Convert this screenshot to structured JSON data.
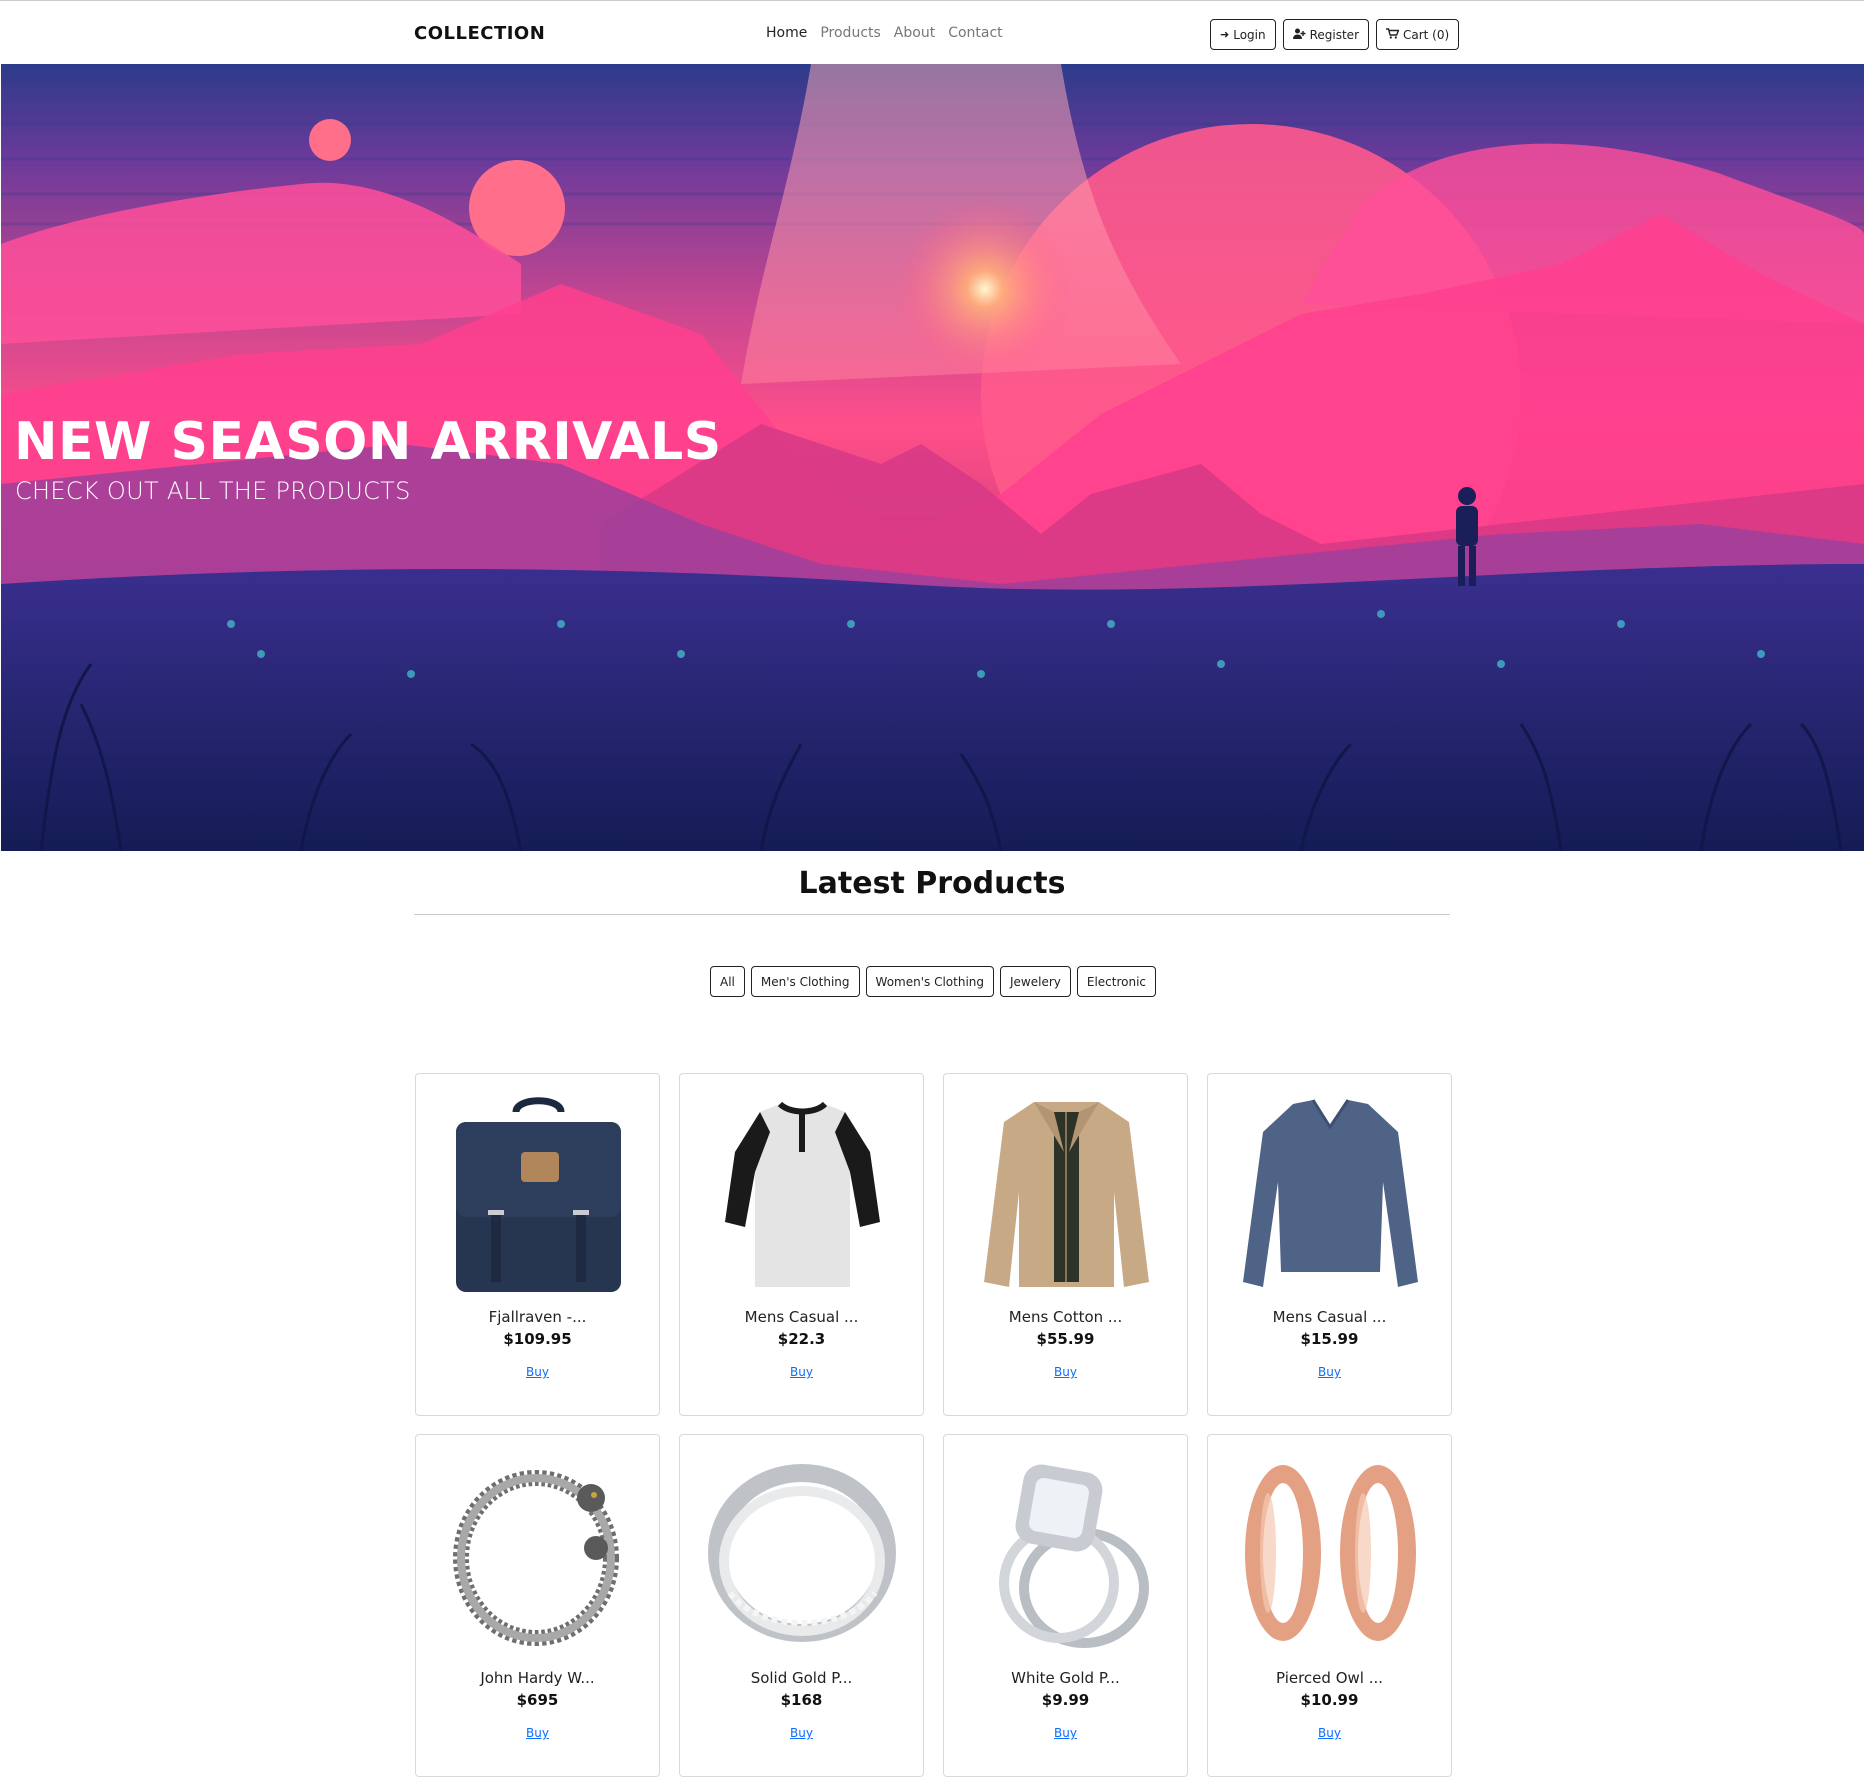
{
  "nav": {
    "brand": "COLLECTION",
    "links": [
      "Home",
      "Products",
      "About",
      "Contact"
    ],
    "login": "Login",
    "register": "Register",
    "cart": "Cart (0)"
  },
  "hero": {
    "title": "NEW SEASON ARRIVALS",
    "subtitle": "CHECK OUT ALL THE PRODUCTS"
  },
  "section": {
    "title": "Latest Products"
  },
  "filters": [
    "All",
    "Men's Clothing",
    "Women's Clothing",
    "Jewelery",
    "Electronic"
  ],
  "products": [
    {
      "name": "Fjallraven -...",
      "price": "$109.95",
      "buy": "Buy",
      "icon": "backpack"
    },
    {
      "name": "Mens Casual ...",
      "price": "$22.3",
      "buy": "Buy",
      "icon": "raglan-tshirt"
    },
    {
      "name": "Mens Cotton ...",
      "price": "$55.99",
      "buy": "Buy",
      "icon": "jacket"
    },
    {
      "name": "Mens Casual ...",
      "price": "$15.99",
      "buy": "Buy",
      "icon": "long-sleeve-shirt"
    },
    {
      "name": "John Hardy W...",
      "price": "$695",
      "buy": "Buy",
      "icon": "bracelet"
    },
    {
      "name": "Solid Gold P...",
      "price": "$168",
      "buy": "Buy",
      "icon": "ring"
    },
    {
      "name": "White Gold P...",
      "price": "$9.99",
      "buy": "Buy",
      "icon": "diamond-ring"
    },
    {
      "name": "Pierced Owl ...",
      "price": "$10.99",
      "buy": "Buy",
      "icon": "ear-plugs"
    }
  ],
  "colors": {
    "accent_link": "#0d6efd",
    "hero_pink": "#ff4f8a",
    "hero_navy": "#1b2566"
  }
}
